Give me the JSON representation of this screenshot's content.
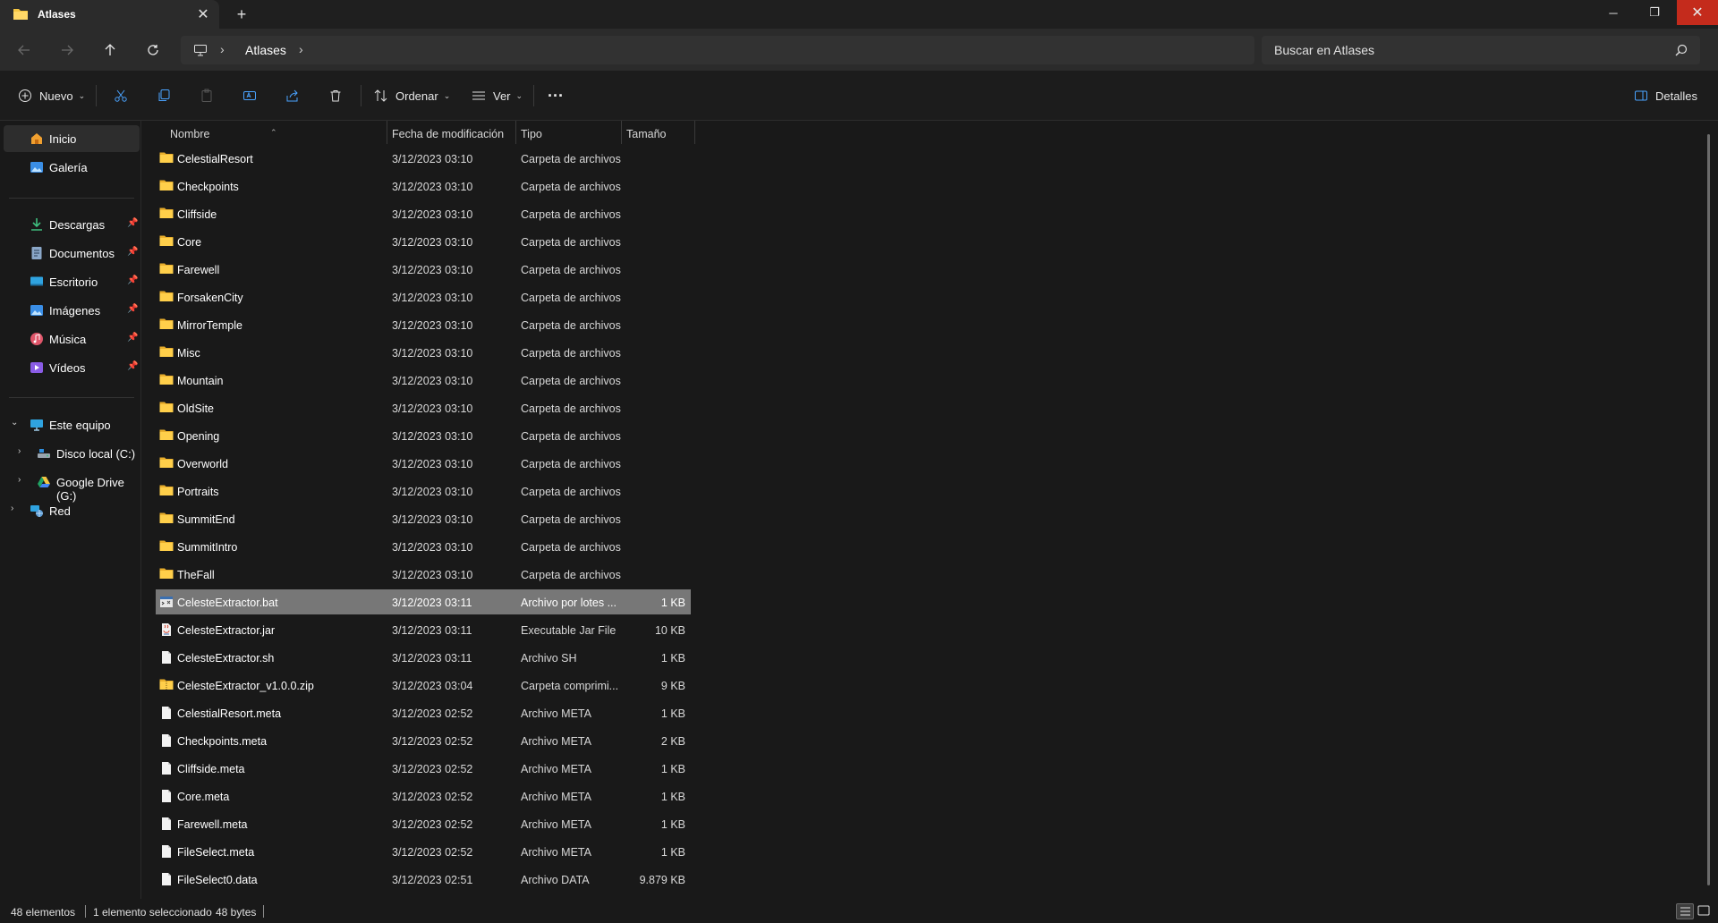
{
  "window": {
    "tab_title": "Atlases",
    "tab_close": "✕",
    "new_tab": "+",
    "minimize": "─",
    "maximize": "❐",
    "close": "✕"
  },
  "address": {
    "crumb": "Atlases",
    "search_placeholder": "Buscar en Atlases"
  },
  "toolbar": {
    "new_label": "Nuevo",
    "sort_label": "Ordenar",
    "view_label": "Ver",
    "more_label": "···",
    "details_label": "Detalles"
  },
  "sidebar": {
    "home": "Inicio",
    "gallery": "Galería",
    "quick": [
      {
        "label": "Descargas",
        "icon": "download-icon"
      },
      {
        "label": "Documentos",
        "icon": "documents-icon"
      },
      {
        "label": "Escritorio",
        "icon": "desktop-icon"
      },
      {
        "label": "Imágenes",
        "icon": "pictures-icon"
      },
      {
        "label": "Música",
        "icon": "music-icon"
      },
      {
        "label": "Vídeos",
        "icon": "videos-icon"
      }
    ],
    "this_pc": "Este equipo",
    "drive_c": "Disco local (C:)",
    "drive_g": "Google Drive (G:)",
    "network": "Red"
  },
  "columns": {
    "name": "Nombre",
    "date": "Fecha de modificación",
    "type": "Tipo",
    "size": "Tamaño"
  },
  "files": [
    {
      "name": "CelestialResort",
      "date": "3/12/2023 03:10",
      "type": "Carpeta de archivos",
      "size": "",
      "kind": "folder"
    },
    {
      "name": "Checkpoints",
      "date": "3/12/2023 03:10",
      "type": "Carpeta de archivos",
      "size": "",
      "kind": "folder"
    },
    {
      "name": "Cliffside",
      "date": "3/12/2023 03:10",
      "type": "Carpeta de archivos",
      "size": "",
      "kind": "folder"
    },
    {
      "name": "Core",
      "date": "3/12/2023 03:10",
      "type": "Carpeta de archivos",
      "size": "",
      "kind": "folder"
    },
    {
      "name": "Farewell",
      "date": "3/12/2023 03:10",
      "type": "Carpeta de archivos",
      "size": "",
      "kind": "folder"
    },
    {
      "name": "ForsakenCity",
      "date": "3/12/2023 03:10",
      "type": "Carpeta de archivos",
      "size": "",
      "kind": "folder"
    },
    {
      "name": "MirrorTemple",
      "date": "3/12/2023 03:10",
      "type": "Carpeta de archivos",
      "size": "",
      "kind": "folder"
    },
    {
      "name": "Misc",
      "date": "3/12/2023 03:10",
      "type": "Carpeta de archivos",
      "size": "",
      "kind": "folder"
    },
    {
      "name": "Mountain",
      "date": "3/12/2023 03:10",
      "type": "Carpeta de archivos",
      "size": "",
      "kind": "folder"
    },
    {
      "name": "OldSite",
      "date": "3/12/2023 03:10",
      "type": "Carpeta de archivos",
      "size": "",
      "kind": "folder"
    },
    {
      "name": "Opening",
      "date": "3/12/2023 03:10",
      "type": "Carpeta de archivos",
      "size": "",
      "kind": "folder"
    },
    {
      "name": "Overworld",
      "date": "3/12/2023 03:10",
      "type": "Carpeta de archivos",
      "size": "",
      "kind": "folder"
    },
    {
      "name": "Portraits",
      "date": "3/12/2023 03:10",
      "type": "Carpeta de archivos",
      "size": "",
      "kind": "folder"
    },
    {
      "name": "SummitEnd",
      "date": "3/12/2023 03:10",
      "type": "Carpeta de archivos",
      "size": "",
      "kind": "folder"
    },
    {
      "name": "SummitIntro",
      "date": "3/12/2023 03:10",
      "type": "Carpeta de archivos",
      "size": "",
      "kind": "folder"
    },
    {
      "name": "TheFall",
      "date": "3/12/2023 03:10",
      "type": "Carpeta de archivos",
      "size": "",
      "kind": "folder"
    },
    {
      "name": "CelesteExtractor.bat",
      "date": "3/12/2023 03:11",
      "type": "Archivo por lotes ...",
      "size": "1 KB",
      "kind": "bat",
      "selected": true
    },
    {
      "name": "CelesteExtractor.jar",
      "date": "3/12/2023 03:11",
      "type": "Executable Jar File",
      "size": "10 KB",
      "kind": "jar"
    },
    {
      "name": "CelesteExtractor.sh",
      "date": "3/12/2023 03:11",
      "type": "Archivo SH",
      "size": "1 KB",
      "kind": "file"
    },
    {
      "name": "CelesteExtractor_v1.0.0.zip",
      "date": "3/12/2023 03:04",
      "type": "Carpeta comprimi...",
      "size": "9 KB",
      "kind": "zip"
    },
    {
      "name": "CelestialResort.meta",
      "date": "3/12/2023 02:52",
      "type": "Archivo META",
      "size": "1 KB",
      "kind": "file"
    },
    {
      "name": "Checkpoints.meta",
      "date": "3/12/2023 02:52",
      "type": "Archivo META",
      "size": "2 KB",
      "kind": "file"
    },
    {
      "name": "Cliffside.meta",
      "date": "3/12/2023 02:52",
      "type": "Archivo META",
      "size": "1 KB",
      "kind": "file"
    },
    {
      "name": "Core.meta",
      "date": "3/12/2023 02:52",
      "type": "Archivo META",
      "size": "1 KB",
      "kind": "file"
    },
    {
      "name": "Farewell.meta",
      "date": "3/12/2023 02:52",
      "type": "Archivo META",
      "size": "1 KB",
      "kind": "file"
    },
    {
      "name": "FileSelect.meta",
      "date": "3/12/2023 02:52",
      "type": "Archivo META",
      "size": "1 KB",
      "kind": "file"
    },
    {
      "name": "FileSelect0.data",
      "date": "3/12/2023 02:51",
      "type": "Archivo DATA",
      "size": "9.879 KB",
      "kind": "file"
    }
  ],
  "status": {
    "count": "48 elementos",
    "selection": "1 elemento seleccionado",
    "selection_size": "48 bytes"
  },
  "colors": {
    "accent_close": "#c42b1c",
    "folder": "#f4c542",
    "selected_row": "#777777"
  }
}
